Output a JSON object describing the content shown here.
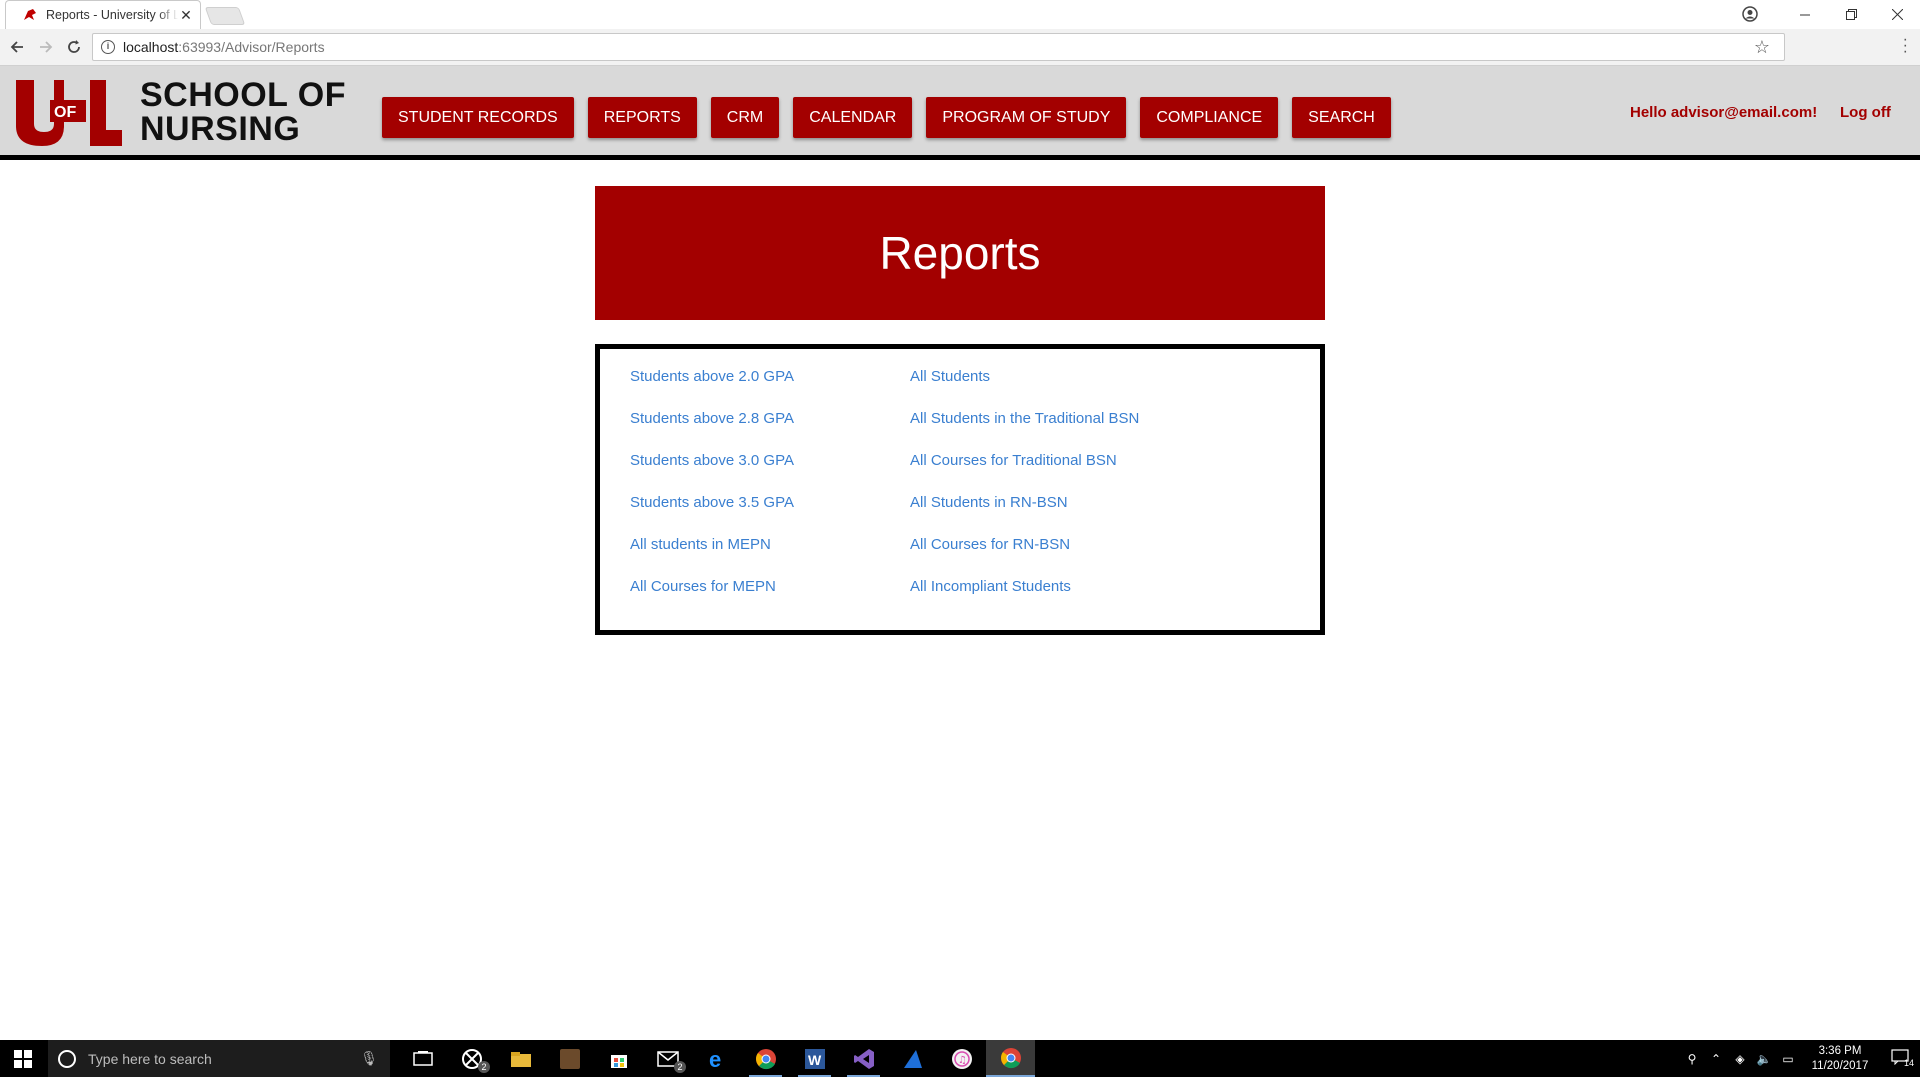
{
  "browser": {
    "tab_title": "Reports - University of Louisville",
    "url_host": "localhost",
    "url_rest": ":63993/Advisor/Reports"
  },
  "site": {
    "logo_text": "UofL",
    "school_line1": "SCHOOL OF",
    "school_line2": "NURSING",
    "nav": [
      "STUDENT RECORDS",
      "REPORTS",
      "CRM",
      "CALENDAR",
      "PROGRAM OF STUDY",
      "COMPLIANCE",
      "SEARCH"
    ],
    "greeting": "Hello advisor@email.com!",
    "logoff": "Log off"
  },
  "page": {
    "title": "Reports",
    "left_links": [
      "Students above 2.0 GPA",
      "Students above 2.8 GPA",
      "Students above 3.0 GPA",
      "Students above 3.5 GPA",
      "All students in MEPN",
      "All Courses for MEPN"
    ],
    "right_links": [
      "All Students",
      "All Students in the Traditional BSN",
      "All Courses for Traditional BSN",
      "All Students in RN-BSN",
      "All Courses for RN-BSN",
      "All Incompliant Students"
    ]
  },
  "taskbar": {
    "search_placeholder": "Type here to search",
    "time": "3:36 PM",
    "date": "11/20/2017",
    "xbox_badge": "2",
    "mail_badge": "2",
    "notification_count": "14"
  },
  "colors": {
    "brand_red": "#a30000",
    "link_blue": "#3a7fd0"
  }
}
